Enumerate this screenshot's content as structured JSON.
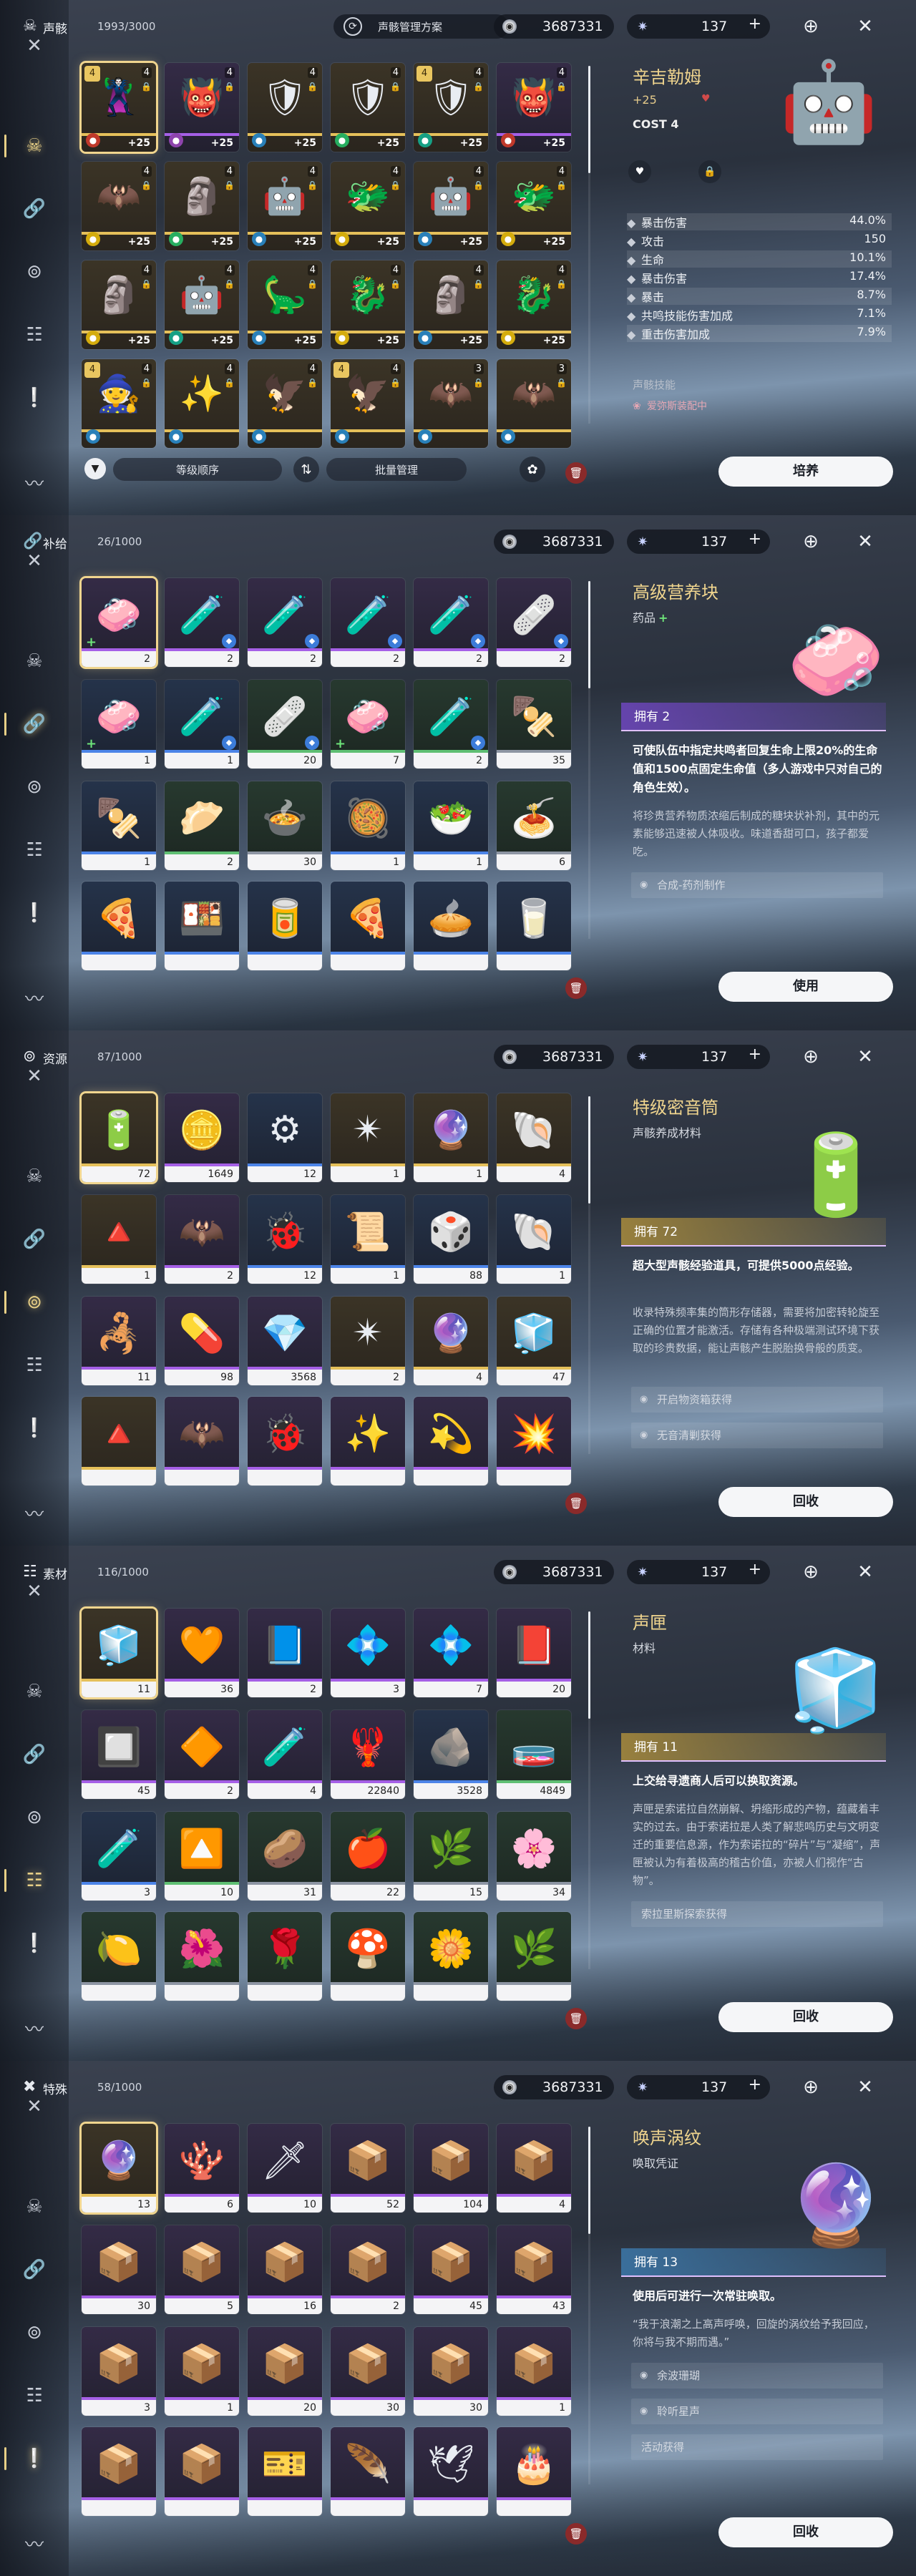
{
  "panels": [
    {
      "category": {
        "label": "声骸",
        "count": "1993/3000",
        "icon": "echo-mask-icon"
      },
      "plan_label": "声骸管理方案",
      "currency": "3687331",
      "waveplate": "137",
      "grid": [
        {
          "art": "🦹",
          "r": "r5",
          "badge": "4",
          "cost": "4",
          "lvl": "+25",
          "elem": "#c0392b",
          "sel": true
        },
        {
          "art": "👹",
          "r": "r4",
          "badge": "",
          "cost": "4",
          "lvl": "+25",
          "elem": "#8e44ad"
        },
        {
          "art": "🛡",
          "r": "r5",
          "badge": "",
          "cost": "4",
          "lvl": "+25",
          "elem": "#2980b9"
        },
        {
          "art": "🛡",
          "r": "r5",
          "badge": "",
          "cost": "4",
          "lvl": "+25",
          "elem": "#27ae60"
        },
        {
          "art": "🛡",
          "r": "r5",
          "badge": "4",
          "cost": "4",
          "lvl": "+25",
          "elem": "#16a085"
        },
        {
          "art": "👹",
          "r": "r4",
          "badge": "",
          "cost": "4",
          "lvl": "+25",
          "elem": "#c0392b"
        },
        {
          "art": "🦇",
          "r": "r5",
          "badge": "",
          "cost": "4",
          "lvl": "+25",
          "elem": "#d4ac0d"
        },
        {
          "art": "🗿",
          "r": "r5",
          "badge": "",
          "cost": "4",
          "lvl": "+25",
          "elem": "#27ae60"
        },
        {
          "art": "🤖",
          "r": "r5",
          "badge": "",
          "cost": "4",
          "lvl": "+25",
          "elem": "#2980b9"
        },
        {
          "art": "🐲",
          "r": "r5",
          "badge": "",
          "cost": "4",
          "lvl": "+25",
          "elem": "#d4ac0d"
        },
        {
          "art": "🤖",
          "r": "r5",
          "badge": "",
          "cost": "4",
          "lvl": "+25",
          "elem": "#2980b9"
        },
        {
          "art": "🐲",
          "r": "r5",
          "badge": "",
          "cost": "4",
          "lvl": "+25",
          "elem": "#d4ac0d"
        },
        {
          "art": "🗿",
          "r": "r5",
          "badge": "",
          "cost": "4",
          "lvl": "+25",
          "elem": "#d4ac0d"
        },
        {
          "art": "🤖",
          "r": "r5",
          "badge": "",
          "cost": "4",
          "lvl": "+25",
          "elem": "#16a085"
        },
        {
          "art": "🦕",
          "r": "r5",
          "badge": "",
          "cost": "4",
          "lvl": "+25",
          "elem": "#2980b9"
        },
        {
          "art": "🐉",
          "r": "r5",
          "badge": "",
          "cost": "4",
          "lvl": "+25",
          "elem": "#d4ac0d"
        },
        {
          "art": "🗿",
          "r": "r5",
          "badge": "",
          "cost": "4",
          "lvl": "+25",
          "elem": "#2980b9"
        },
        {
          "art": "🐉",
          "r": "r5",
          "badge": "",
          "cost": "4",
          "lvl": "+25",
          "elem": "#d4ac0d"
        },
        {
          "art": "🧙",
          "r": "r5",
          "badge": "4",
          "cost": "4",
          "lvl": "",
          "elem": "#2980b9"
        },
        {
          "art": "✨",
          "r": "r5",
          "badge": "",
          "cost": "4",
          "lvl": "",
          "elem": "#2980b9"
        },
        {
          "art": "🦅",
          "r": "r5",
          "badge": "",
          "cost": "4",
          "lvl": "",
          "elem": "#2980b9"
        },
        {
          "art": "🦅",
          "r": "r5",
          "badge": "4",
          "cost": "4",
          "lvl": "",
          "elem": "#2980b9"
        },
        {
          "art": "🦇",
          "r": "r5",
          "badge": "",
          "cost": "3",
          "lvl": "",
          "elem": "#2980b9"
        },
        {
          "art": "🦇",
          "r": "r5",
          "badge": "",
          "cost": "3",
          "lvl": "",
          "elem": "#2980b9"
        }
      ],
      "bottom": {
        "sort": "等级顺序",
        "batch": "批量管理"
      },
      "detail": {
        "name": "辛吉勒姆",
        "level": "+25",
        "cost": "COST  4",
        "stats": [
          {
            "icon": "crit-dmg-icon",
            "label": "暴击伤害",
            "value": "44.0%",
            "hl": true
          },
          {
            "icon": "atk-icon",
            "label": "攻击",
            "value": "150",
            "hl": false
          },
          {
            "icon": "hp-icon",
            "label": "生命",
            "value": "10.1%",
            "hl": true
          },
          {
            "icon": "crit-dmg-icon",
            "label": "暴击伤害",
            "value": "17.4%",
            "hl": false
          },
          {
            "icon": "crit-icon",
            "label": "暴击",
            "value": "8.7%",
            "hl": true
          },
          {
            "icon": "resonance-skill-icon",
            "label": "共鸣技能伤害加成",
            "value": "7.1%",
            "hl": false
          },
          {
            "icon": "heavy-atk-icon",
            "label": "重击伤害加成",
            "value": "7.9%",
            "hl": true
          }
        ],
        "skill_label": "声骸技能",
        "equipped": "爱弥斯装配中"
      },
      "action": "培养"
    },
    {
      "category": {
        "label": "补给",
        "count": "26/1000",
        "icon": "supply-icon"
      },
      "currency": "3687331",
      "waveplate": "137",
      "grid": [
        {
          "art": "🧼",
          "r": "r4",
          "qty": "2",
          "sel": true,
          "plus": true
        },
        {
          "art": "🧪",
          "r": "r4",
          "qty": "2",
          "tag": true
        },
        {
          "art": "🧪",
          "r": "r4",
          "qty": "2",
          "tag": true
        },
        {
          "art": "🧪",
          "r": "r4",
          "qty": "2",
          "tag": true
        },
        {
          "art": "🧪",
          "r": "r4",
          "qty": "2",
          "tag": true
        },
        {
          "art": "🩹",
          "r": "r4",
          "qty": "2",
          "tag": true
        },
        {
          "art": "🧼",
          "r": "r3",
          "qty": "1",
          "plus": true
        },
        {
          "art": "🧪",
          "r": "r3",
          "qty": "1",
          "tag": true
        },
        {
          "art": "🩹",
          "r": "r2",
          "qty": "20",
          "tag": true
        },
        {
          "art": "🧼",
          "r": "r2",
          "qty": "7",
          "plus": true
        },
        {
          "art": "🧪",
          "r": "r2",
          "qty": "2",
          "tag": true
        },
        {
          "art": "🍢",
          "r": "r1",
          "qty": "35"
        },
        {
          "art": "🍢",
          "r": "r3",
          "qty": "1"
        },
        {
          "art": "🥟",
          "r": "r2",
          "qty": "2"
        },
        {
          "art": "🍲",
          "r": "r1",
          "qty": "30"
        },
        {
          "art": "🥘",
          "r": "r3",
          "qty": "1"
        },
        {
          "art": "🥗",
          "r": "r3",
          "qty": "1"
        },
        {
          "art": "🍝",
          "r": "r1",
          "qty": "6"
        },
        {
          "art": "🍕",
          "r": "r3",
          "qty": ""
        },
        {
          "art": "🍱",
          "r": "r3",
          "qty": ""
        },
        {
          "art": "🥫",
          "r": "r3",
          "qty": ""
        },
        {
          "art": "🍕",
          "r": "r3",
          "qty": ""
        },
        {
          "art": "🥧",
          "r": "r3",
          "qty": ""
        },
        {
          "art": "🥛",
          "r": "r3",
          "qty": ""
        }
      ],
      "detail": {
        "name": "高级营养块",
        "type": "药品",
        "owned": "拥有 2",
        "effect": "可使队伍中指定共鸣者回复生命上限20%的生命值和1500点固定生命值（多人游戏中只对自己的角色生效）。",
        "desc": "将珍贵营养物质浓缩后制成的糖块状补剂，其中的元素能够迅速被人体吸收。味道香甜可口，孩子都爱吃。",
        "sources": [
          {
            "text": "合成-药剂制作"
          }
        ]
      },
      "action": "使用"
    },
    {
      "category": {
        "label": "资源",
        "count": "87/1000",
        "icon": "resource-icon"
      },
      "currency": "3687331",
      "waveplate": "137",
      "grid": [
        {
          "art": "🔋",
          "r": "r5",
          "qty": "72",
          "sel": true
        },
        {
          "art": "🪙",
          "r": "r4",
          "qty": "1649"
        },
        {
          "art": "⚙",
          "r": "r3",
          "qty": "12"
        },
        {
          "art": "✴",
          "r": "r5",
          "qty": "1"
        },
        {
          "art": "🔮",
          "r": "r5",
          "qty": "1"
        },
        {
          "art": "🐚",
          "r": "r5",
          "qty": "4"
        },
        {
          "art": "🔺",
          "r": "r5",
          "qty": "1"
        },
        {
          "art": "🦇",
          "r": "r4",
          "qty": "2"
        },
        {
          "art": "🐞",
          "r": "r3",
          "qty": "12"
        },
        {
          "art": "📜",
          "r": "r3",
          "qty": "1"
        },
        {
          "art": "🎲",
          "r": "r3",
          "qty": "88"
        },
        {
          "art": "🐚",
          "r": "r3",
          "qty": "1"
        },
        {
          "art": "🦂",
          "r": "r4",
          "qty": "11"
        },
        {
          "art": "💊",
          "r": "r4",
          "qty": "98"
        },
        {
          "art": "💎",
          "r": "r4",
          "qty": "3568"
        },
        {
          "art": "✴",
          "r": "r5",
          "qty": "2"
        },
        {
          "art": "🔮",
          "r": "r5",
          "qty": "4"
        },
        {
          "art": "🧊",
          "r": "r5",
          "qty": "47"
        },
        {
          "art": "🔺",
          "r": "r5",
          "qty": ""
        },
        {
          "art": "🦇",
          "r": "r4",
          "qty": ""
        },
        {
          "art": "🐞",
          "r": "r4",
          "qty": ""
        },
        {
          "art": "✨",
          "r": "r4",
          "qty": ""
        },
        {
          "art": "💫",
          "r": "r4",
          "qty": ""
        },
        {
          "art": "💥",
          "r": "r4",
          "qty": ""
        }
      ],
      "detail": {
        "name": "特级密音筒",
        "type": "声骸养成材料",
        "owned": "拥有 72",
        "effect": "超大型声骸经验道具，可提供5000点经验。",
        "desc": "收录特殊频率集的筒形存储器，需要将加密转轮旋至正确的位置才能激活。存储有各种极端测试环境下获取的珍贵数据，能让声骸产生脱胎换骨般的质变。",
        "sources": [
          {
            "text": "开启物资箱获得"
          },
          {
            "text": "无音清剿获得"
          }
        ]
      },
      "action": "回收"
    },
    {
      "category": {
        "label": "素材",
        "count": "116/1000",
        "icon": "material-icon"
      },
      "currency": "3687331",
      "waveplate": "137",
      "grid": [
        {
          "art": "🧊",
          "r": "r5",
          "qty": "11",
          "sel": true
        },
        {
          "art": "🧡",
          "r": "r4",
          "qty": "36"
        },
        {
          "art": "📘",
          "r": "r4",
          "qty": "2"
        },
        {
          "art": "💠",
          "r": "r4",
          "qty": "3"
        },
        {
          "art": "💠",
          "r": "r4",
          "qty": "7"
        },
        {
          "art": "📕",
          "r": "r4",
          "qty": "20"
        },
        {
          "art": "🔲",
          "r": "r4",
          "qty": "45"
        },
        {
          "art": "🔶",
          "r": "r4",
          "qty": "2"
        },
        {
          "art": "🧪",
          "r": "r4",
          "qty": "4"
        },
        {
          "art": "🦞",
          "r": "r4",
          "qty": "22840"
        },
        {
          "art": "🪨",
          "r": "r3",
          "qty": "3528"
        },
        {
          "art": "🧫",
          "r": "r2",
          "qty": "4849"
        },
        {
          "art": "🧪",
          "r": "r3",
          "qty": "3"
        },
        {
          "art": "🔼",
          "r": "r2",
          "qty": "10"
        },
        {
          "art": "🥔",
          "r": "r1",
          "qty": "31"
        },
        {
          "art": "🍎",
          "r": "r1",
          "qty": "22"
        },
        {
          "art": "🌿",
          "r": "r1",
          "qty": "15"
        },
        {
          "art": "🌸",
          "r": "r1",
          "qty": "34"
        },
        {
          "art": "🍋",
          "r": "r1",
          "qty": ""
        },
        {
          "art": "🌺",
          "r": "r1",
          "qty": ""
        },
        {
          "art": "🌹",
          "r": "r1",
          "qty": ""
        },
        {
          "art": "🍄",
          "r": "r1",
          "qty": ""
        },
        {
          "art": "🌼",
          "r": "r1",
          "qty": ""
        },
        {
          "art": "🌿",
          "r": "r1",
          "qty": ""
        }
      ],
      "detail": {
        "name": "声匣",
        "type": "材料",
        "owned": "拥有 11",
        "effect": "上交给寻遗商人后可以换取资源。",
        "desc": "声匣是索诺拉自然崩解、坍缩形成的产物，蕴藏着丰实的过去。由于索诺拉是人类了解悲鸣历史与文明变迁的重要信息源，作为索诺拉的“碎片”与“凝缩”，声匣被认为有着极高的稽古价值，亦被人们视作“古物”。",
        "sources": [
          {
            "text": "索拉里斯探索获得",
            "plain": true
          }
        ]
      },
      "action": "回收"
    },
    {
      "category": {
        "label": "特殊",
        "count": "58/1000",
        "icon": "special-icon"
      },
      "currency": "3687331",
      "waveplate": "137",
      "grid": [
        {
          "art": "🔮",
          "r": "r5",
          "qty": "13",
          "sel": true
        },
        {
          "art": "🪸",
          "r": "r4",
          "qty": "6"
        },
        {
          "art": "🗡",
          "r": "r4",
          "qty": "10"
        },
        {
          "art": "📦",
          "r": "r4",
          "qty": "52"
        },
        {
          "art": "📦",
          "r": "r4",
          "qty": "104"
        },
        {
          "art": "📦",
          "r": "r4",
          "qty": "4"
        },
        {
          "art": "📦",
          "r": "r4",
          "qty": "30"
        },
        {
          "art": "📦",
          "r": "r4",
          "qty": "5"
        },
        {
          "art": "📦",
          "r": "r4",
          "qty": "16"
        },
        {
          "art": "📦",
          "r": "r4",
          "qty": "2"
        },
        {
          "art": "📦",
          "r": "r4",
          "qty": "45"
        },
        {
          "art": "📦",
          "r": "r4",
          "qty": "43"
        },
        {
          "art": "📦",
          "r": "r4",
          "qty": "3"
        },
        {
          "art": "📦",
          "r": "r4",
          "qty": "1"
        },
        {
          "art": "📦",
          "r": "r4",
          "qty": "20"
        },
        {
          "art": "📦",
          "r": "r4",
          "qty": "30"
        },
        {
          "art": "📦",
          "r": "r4",
          "qty": "30"
        },
        {
          "art": "📦",
          "r": "r4",
          "qty": "1"
        },
        {
          "art": "📦",
          "r": "r4",
          "qty": ""
        },
        {
          "art": "📦",
          "r": "r4",
          "qty": ""
        },
        {
          "art": "🎫",
          "r": "r4",
          "qty": ""
        },
        {
          "art": "🪶",
          "r": "r4",
          "qty": ""
        },
        {
          "art": "🕊",
          "r": "r4",
          "qty": ""
        },
        {
          "art": "🎂",
          "r": "r4",
          "qty": ""
        }
      ],
      "detail": {
        "name": "唤声涡纹",
        "type": "唤取凭证",
        "owned": "拥有 13",
        "effect": "使用后可进行一次常驻唤取。",
        "desc": "“我于浪潮之上高声呼唤，回旋的涡纹给予我回应，你将与我不期而遇。”",
        "sources": [
          {
            "text": "余波珊瑚"
          },
          {
            "text": "聆听星声"
          },
          {
            "text": "活动获得",
            "plain": true
          }
        ]
      },
      "action": "回收"
    }
  ],
  "sidebar_icons": [
    "close-crossed-swords-icon",
    "echo-icon",
    "supply-icon",
    "resource-icon",
    "material-icon",
    "special-icon",
    "wave-icon"
  ]
}
